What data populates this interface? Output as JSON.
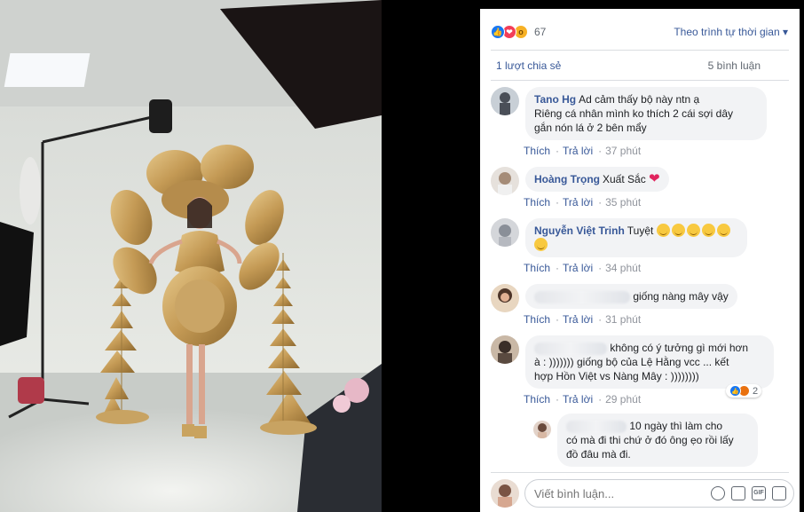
{
  "post": {
    "reaction_count": "67",
    "sort_label": "Theo trình tự thời gian",
    "shares_label": "1 lượt chia sẻ",
    "comments_label": "5 bình luận"
  },
  "comments": [
    {
      "author": "Tano Hg",
      "text_line1": "Ad cảm thấy bộ này ntn ạ",
      "text_line2": "Riêng cá nhân mình ko thích 2 cái sợi dây",
      "text_line3": "gắn nón lá ở 2 bên mẩy",
      "like": "Thích",
      "reply": "Trả lời",
      "time": "37 phút"
    },
    {
      "author": "Hoàng Trọng",
      "text": "Xuất Sắc",
      "like": "Thích",
      "reply": "Trả lời",
      "time": "35 phút"
    },
    {
      "author": "Nguyễn Việt Trinh",
      "text": "Tuyệt",
      "like": "Thích",
      "reply": "Trả lời",
      "time": "34 phút"
    },
    {
      "text": "giống nàng mây vậy",
      "like": "Thích",
      "reply": "Trả lời",
      "time": "31 phút"
    },
    {
      "text_line1": "không có ý tưởng gì mới hơn",
      "text_line2": "à : ))))))) giống bộ của Lệ Hằng vcc ... kết",
      "text_line3": "hợp Hồn Việt vs Nàng Mây : ))))))))",
      "reactions": "2",
      "like": "Thích",
      "reply": "Trả lời",
      "time": "29 phút"
    }
  ],
  "reply": {
    "text_line1": "10 ngày thì làm cho",
    "text_line2": "có mà đi thi chứ ở đó ông ẹo rồi lấy",
    "text_line3": "đồ đâu mà đi."
  },
  "composer": {
    "placeholder": "Viết bình luận..."
  },
  "icons": {
    "like": "like-icon",
    "love": "love-icon",
    "wow": "wow-icon",
    "sort": "caret-down-icon",
    "emoji": "emoji-icon",
    "camera": "camera-icon",
    "gif": "gif-icon",
    "sticker": "sticker-icon"
  },
  "colors": {
    "link": "#385898",
    "like_blue": "#1877f2",
    "love_red": "#f33e58",
    "bubble_bg": "#f2f3f5"
  }
}
